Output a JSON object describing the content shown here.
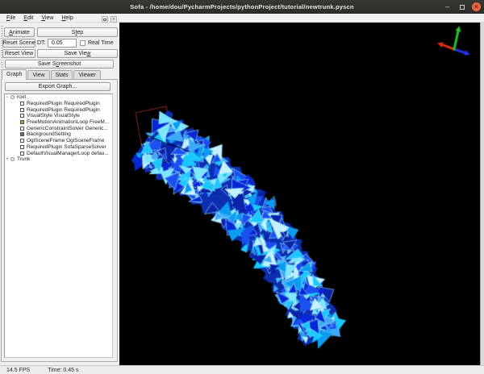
{
  "window": {
    "title": "Sofa - /home/dou/PycharmProjects/pythonProject/tutorial/newtrunk.pyscn",
    "controls": {
      "minimize": "–",
      "close": "×"
    }
  },
  "menu": {
    "items": [
      {
        "label": "File",
        "mnemonic": 0
      },
      {
        "label": "Edit",
        "mnemonic": 0
      },
      {
        "label": "View",
        "mnemonic": 0
      },
      {
        "label": "Help",
        "mnemonic": 0
      }
    ]
  },
  "dock": {
    "close_glyph": "×"
  },
  "sim_controls": {
    "animate": {
      "label": "Animate",
      "mnemonic": 0
    },
    "step": {
      "label": "Step",
      "mnemonic": 1
    },
    "reset_scene": {
      "label": "Reset Scene",
      "mnemonic": -1
    },
    "dt_label": "DT:",
    "dt_value": "0.05",
    "real_time_label": "Real Time",
    "real_time_checked": false,
    "reset_view": {
      "label": "Reset View",
      "mnemonic": -1
    },
    "save_view": {
      "label": "Save View",
      "mnemonic": 8
    },
    "save_screenshot": {
      "label": "Save Screenshot",
      "mnemonic": 6
    }
  },
  "tabs": [
    {
      "label": "Graph",
      "active": true
    },
    {
      "label": "View",
      "active": false
    },
    {
      "label": "Stats",
      "active": false
    },
    {
      "label": "Viewer",
      "active": false
    }
  ],
  "graph_panel": {
    "export_button": "Export Graph...",
    "tree": [
      {
        "label": "root",
        "icon": "node",
        "expand": "−",
        "indent": 0
      },
      {
        "label": "RequiredPlugin RequiredPlugin",
        "icon": "box",
        "color": "#ffffff",
        "expand": "",
        "indent": 1
      },
      {
        "label": "RequiredPlugin RequiredPlugin",
        "icon": "box",
        "color": "#ffffff",
        "expand": "",
        "indent": 1
      },
      {
        "label": "VisualStyle VisualStyle",
        "icon": "box",
        "color": "#ffffff",
        "expand": "",
        "indent": 1
      },
      {
        "label": "FreeMotionAnimationLoop FreeM...",
        "icon": "box",
        "color": "#7ab648",
        "expand": "",
        "indent": 1
      },
      {
        "label": "GenericConstraintSolver Generic...",
        "icon": "box",
        "color": "#ffffff",
        "expand": "",
        "indent": 1
      },
      {
        "label": "BackgroundSetting",
        "icon": "box",
        "color": "#6e6e6e",
        "expand": "",
        "indent": 1
      },
      {
        "label": "OglSceneFrame OglSceneFrame",
        "icon": "box",
        "color": "#ffffff",
        "expand": "",
        "indent": 1
      },
      {
        "label": "RequiredPlugin SofaSparseSolver",
        "icon": "box",
        "color": "#ffffff",
        "expand": "",
        "indent": 1
      },
      {
        "label": "DefaultVisualManagerLoop defau...",
        "icon": "box",
        "color": "#ffffff",
        "expand": "",
        "indent": 1
      },
      {
        "label": "Trunk",
        "icon": "node",
        "expand": "+",
        "indent": 0
      }
    ]
  },
  "status": {
    "fps": "14.5 FPS",
    "time": "Time: 0.45 s"
  },
  "viewport": {
    "background": "#000000",
    "axis_gizmo": {
      "origin": [
        415,
        33
      ],
      "x_axis": {
        "color": "#dd2b1d",
        "tip": [
          396,
          26
        ]
      },
      "y_axis": {
        "color": "#25c425",
        "tip": [
          421,
          6
        ]
      },
      "z_axis": {
        "color": "#2331e8",
        "tip": [
          433,
          39
        ]
      }
    },
    "base_box": {
      "color": "#7b241c",
      "points": [
        [
          20,
          112
        ],
        [
          58,
          104
        ],
        [
          69,
          163
        ],
        [
          31,
          171
        ]
      ]
    },
    "trunk": {
      "path": [
        [
          37,
          140
        ],
        [
          90,
          178
        ],
        [
          142,
          220
        ],
        [
          186,
          268
        ],
        [
          218,
          320
        ],
        [
          240,
          362
        ],
        [
          252,
          392
        ]
      ],
      "r_start": 37,
      "r_end": 26,
      "base_color": "#0c2fb0",
      "palette": [
        "#0626d8",
        "#1b50f0",
        "#0b9cf0",
        "#19c8ff",
        "#7fe6ff",
        "#0b23a8",
        "#3fa9f5",
        "#c2f2ff"
      ],
      "edge_color": "#9beaff",
      "crack": [
        [
          22,
          135
        ],
        [
          40,
          142
        ],
        [
          58,
          150
        ],
        [
          74,
          155
        ],
        [
          87,
          160
        ]
      ],
      "facets": 400,
      "seed": 11
    }
  }
}
